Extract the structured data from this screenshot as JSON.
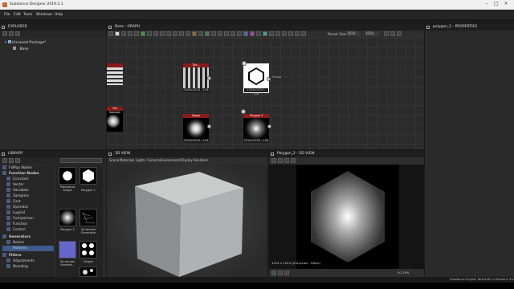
{
  "app": {
    "title": "Substance Designer 2019.3.1",
    "menu": [
      "File",
      "Edit",
      "Tools",
      "Windows",
      "Help"
    ]
  },
  "explorer": {
    "header": "EXPLORER",
    "package": "Unsaved Package*",
    "graph": "Base"
  },
  "library": {
    "header": "LIBRARY",
    "search_placeholder": "",
    "items": [
      {
        "label": "FxMap Nodes",
        "level": 0
      },
      {
        "label": "Function Nodes",
        "level": 0
      },
      {
        "label": "Constant",
        "level": 1
      },
      {
        "label": "Vector",
        "level": 1
      },
      {
        "label": "Variables",
        "level": 1
      },
      {
        "label": "Samplers",
        "level": 1
      },
      {
        "label": "Cast",
        "level": 1
      },
      {
        "label": "Operator",
        "level": 1
      },
      {
        "label": "Logical",
        "level": 1
      },
      {
        "label": "Comparison",
        "level": 1
      },
      {
        "label": "Function",
        "level": 1
      },
      {
        "label": "Control",
        "level": 1
      },
      {
        "label": "Generators",
        "level": 0
      },
      {
        "label": "Noises",
        "level": 1
      },
      {
        "label": "Patterns",
        "level": 1
      },
      {
        "label": "Filters",
        "level": 0
      },
      {
        "label": "Adjustments",
        "level": 1
      },
      {
        "label": "Blending",
        "level": 1
      }
    ],
    "thumbs": [
      {
        "label": "Panorama Shape"
      },
      {
        "label": "Polygon 1"
      },
      {
        "label": "Polygon 2"
      },
      {
        "label": "Scratches Generator"
      },
      {
        "label": "Scratches Generat..."
      },
      {
        "label": "Shape"
      }
    ]
  },
  "graph": {
    "header": "Base - GRAPH",
    "parent_size_label": "Parent Size:",
    "parent_size_x": "1024",
    "parent_size_y": "1024",
    "nodes": [
      {
        "title": "",
        "footer": ""
      },
      {
        "title": "Tile...",
        "footer": "1024x1024 - L16"
      },
      {
        "title": "",
        "footer": "1024x1024 - L16"
      },
      {
        "title": "Tile Sampler",
        "footer": ""
      },
      {
        "title": "Shape",
        "footer": "1024x1024 - L16"
      },
      {
        "title": "Polygon 2",
        "footer": "1024x1024 - L16"
      }
    ],
    "output_label": "Shape"
  },
  "properties": {
    "header": "polygon_1 - PROPERTIES"
  },
  "view3d": {
    "header": "3D VIEW",
    "menu": [
      "Scene",
      "Materials",
      "Lights",
      "Camera",
      "Environment",
      "Display",
      "Renderer"
    ]
  },
  "view2d": {
    "header": "Polygon_2 - 2D VIEW",
    "info": "1024 x 1024 (Grayscale, 16bpc)",
    "zoom": "50.79%"
  },
  "status": {
    "text": "Substance Engine: Direct3D 11   Memory: 0%"
  }
}
